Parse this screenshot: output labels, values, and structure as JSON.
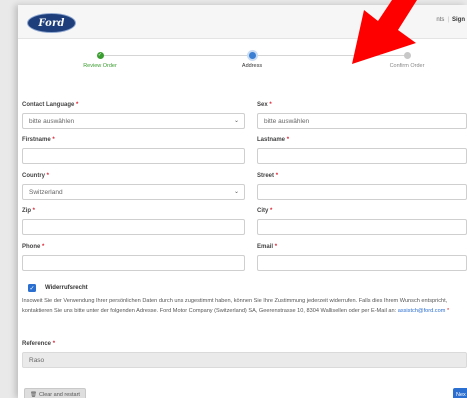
{
  "header": {
    "logo_text": "Ford",
    "nav_partial": "nts",
    "nav_sign": "Sign"
  },
  "stepper": {
    "steps": [
      {
        "label": "Review Order",
        "state": "done"
      },
      {
        "label": "Address",
        "state": "active"
      },
      {
        "label": "Confirm Order",
        "state": "todo"
      }
    ]
  },
  "form": {
    "contact_language": {
      "label": "Contact Language",
      "value": "bitte auswählen"
    },
    "sex": {
      "label": "Sex",
      "value": "bitte auswählen"
    },
    "firstname": {
      "label": "Firstname",
      "value": ""
    },
    "lastname": {
      "label": "Lastname",
      "value": ""
    },
    "country": {
      "label": "Country",
      "value": "Switzerland"
    },
    "street": {
      "label": "Street",
      "value": ""
    },
    "zip": {
      "label": "Zip",
      "value": ""
    },
    "city": {
      "label": "City",
      "value": ""
    },
    "phone": {
      "label": "Phone",
      "value": ""
    },
    "email": {
      "label": "Email",
      "value": ""
    },
    "required_marker": "*"
  },
  "consent": {
    "checkbox_label": "Widerrufsrecht",
    "text": "Insoweit Sie der Verwendung Ihrer persönlichen Daten durch uns zugestimmt haben, können Sie Ihre Zustimmung jederzeit widerrufen. Falls dies Ihrem Wunsch entspricht, kontaktieren Sie uns bitte unter der folgenden Adresse. Ford Motor Company (Switzerland) SA, Geerenstrasse 10, 8304 Wallisellen oder per E-Mail an:",
    "email_link": "assistch@ford.com",
    "required_marker": "*"
  },
  "reference": {
    "label": "Reference",
    "value": "Raso"
  },
  "buttons": {
    "clear_icon": "trash-icon",
    "clear_label": "Clear and restart",
    "next_label": "Nex"
  },
  "colors": {
    "ford_blue": "#1d3e7b",
    "primary": "#2b6fd0",
    "success": "#3a9d2f",
    "required": "#dd2233",
    "annotation_arrow": "#ff0000"
  }
}
